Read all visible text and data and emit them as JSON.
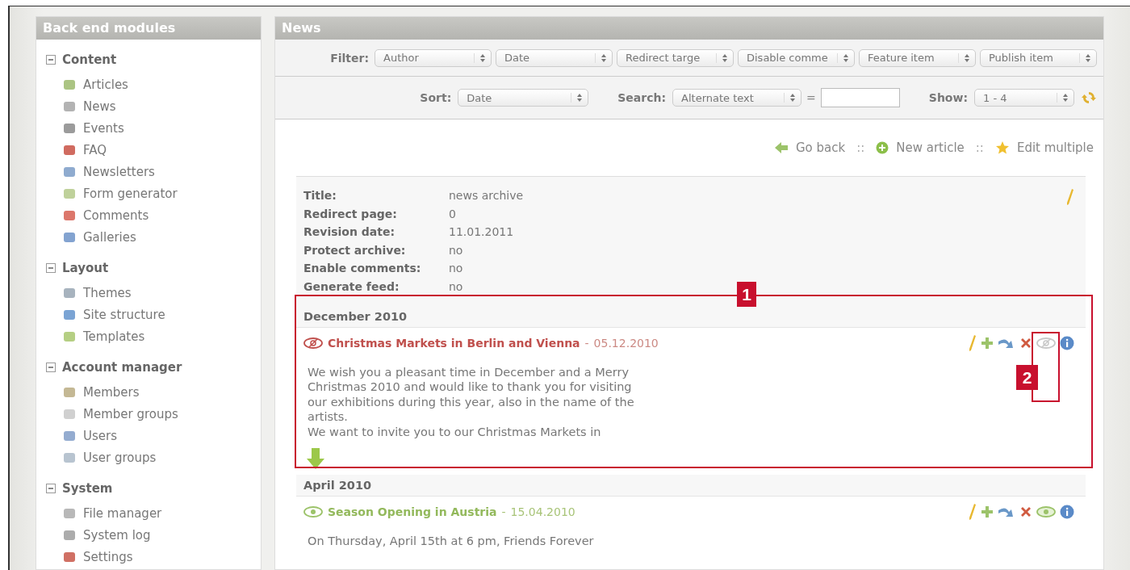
{
  "sidebar": {
    "title": "Back end modules",
    "groups": [
      {
        "label": "Content",
        "expanded": true,
        "items": [
          {
            "label": "Articles"
          },
          {
            "label": "News"
          },
          {
            "label": "Events"
          },
          {
            "label": "FAQ"
          },
          {
            "label": "Newsletters"
          },
          {
            "label": "Form generator"
          },
          {
            "label": "Comments"
          },
          {
            "label": "Galleries"
          }
        ]
      },
      {
        "label": "Layout",
        "expanded": true,
        "items": [
          {
            "label": "Themes"
          },
          {
            "label": "Site structure"
          },
          {
            "label": "Templates"
          }
        ]
      },
      {
        "label": "Account manager",
        "expanded": true,
        "items": [
          {
            "label": "Members"
          },
          {
            "label": "Member groups"
          },
          {
            "label": "Users"
          },
          {
            "label": "User groups"
          }
        ]
      },
      {
        "label": "System",
        "expanded": true,
        "items": [
          {
            "label": "File manager"
          },
          {
            "label": "System log"
          },
          {
            "label": "Settings"
          }
        ]
      }
    ]
  },
  "main": {
    "title": "News",
    "filter": {
      "label": "Filter:",
      "selects": [
        "Author",
        "Date",
        "Redirect targe",
        "Disable comme",
        "Feature item",
        "Publish item"
      ]
    },
    "sort": {
      "label": "Sort:",
      "value": "Date"
    },
    "search": {
      "label": "Search:",
      "field": "Alternate text",
      "operator": "="
    },
    "show": {
      "label": "Show:",
      "value": "1 - 4"
    },
    "links": [
      {
        "label": "Go back"
      },
      {
        "label": "New article"
      },
      {
        "label": "Edit multiple"
      }
    ],
    "link_separator": "::",
    "archive": {
      "fields": [
        {
          "label": "Title:",
          "value": "news archive"
        },
        {
          "label": "Redirect page:",
          "value": "0"
        },
        {
          "label": "Revision date:",
          "value": "11.01.2011"
        },
        {
          "label": "Protect archive:",
          "value": "no"
        },
        {
          "label": "Enable comments:",
          "value": "no"
        },
        {
          "label": "Generate feed:",
          "value": "no"
        }
      ]
    },
    "groups": [
      {
        "month": "December 2010",
        "callout": "1",
        "articles": [
          {
            "title": "Christmas Markets in Berlin and Vienna",
            "separator": "-",
            "date": "05.12.2010",
            "published": false,
            "callout": "2",
            "teaser": [
              "We wish you a pleasant time in December and a Merry",
              "Christmas 2010 and would like to thank you for visiting",
              "our exhibitions during this year, also in the name of the",
              "artists.",
              "We want to invite you to our Christmas Markets in"
            ],
            "more": true
          }
        ]
      },
      {
        "month": "April 2010",
        "articles": [
          {
            "title": "Season Opening in Austria",
            "separator": "-",
            "date": "15.04.2010",
            "published": true,
            "teaser": [
              "On Thursday, April 15th at 6 pm, Friends Forever"
            ],
            "more": false
          }
        ]
      }
    ]
  }
}
